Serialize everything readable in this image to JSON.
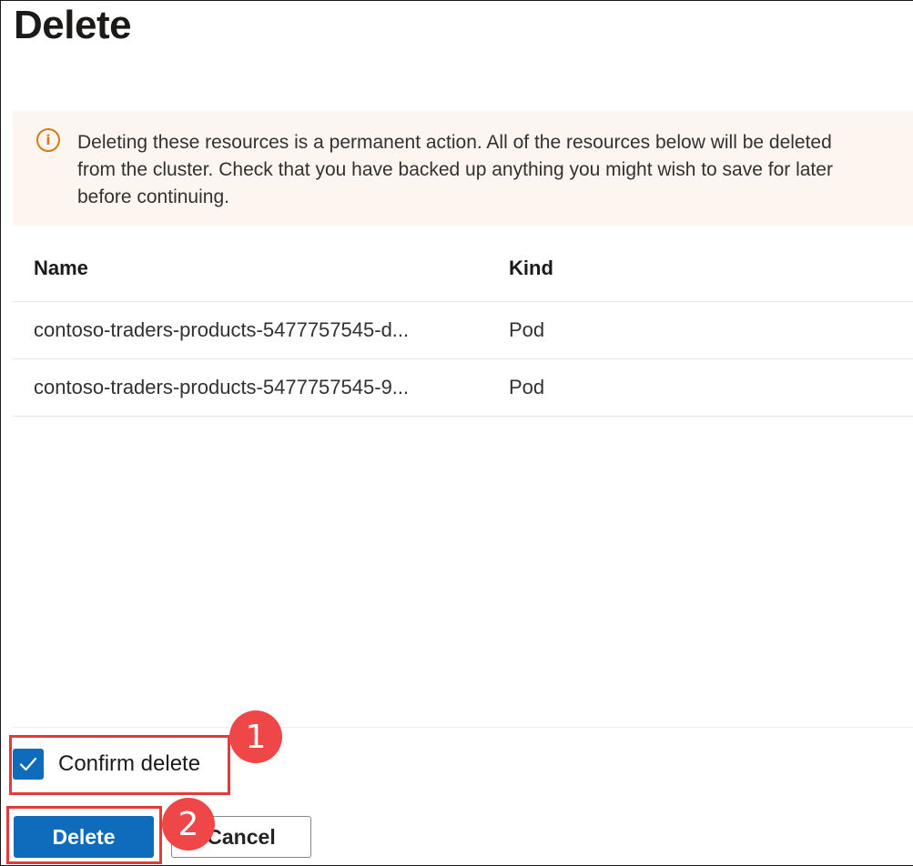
{
  "dialog": {
    "title": "Delete"
  },
  "warning": {
    "icon": "info-icon",
    "icon_glyph": "i",
    "text": "Deleting these resources is a permanent action. All of the resources below will be deleted\nfrom the cluster. Check that you have backed up anything you might wish to save for later\nbefore continuing."
  },
  "table": {
    "columns": [
      "Name",
      "Kind"
    ],
    "rows": [
      {
        "name": "contoso-traders-products-5477757545-d...",
        "kind": "Pod"
      },
      {
        "name": "contoso-traders-products-5477757545-9...",
        "kind": "Pod"
      }
    ]
  },
  "confirm": {
    "label": "Confirm delete",
    "checked": true
  },
  "buttons": {
    "delete_label": "Delete",
    "cancel_label": "Cancel"
  },
  "annotations": {
    "step1": "1",
    "step2": "2"
  },
  "colors": {
    "accent": "#0f6cbd",
    "warning_bg": "#fdf6f0",
    "warning_icon": "#d47a16",
    "annotation_red": "#ef4747"
  }
}
